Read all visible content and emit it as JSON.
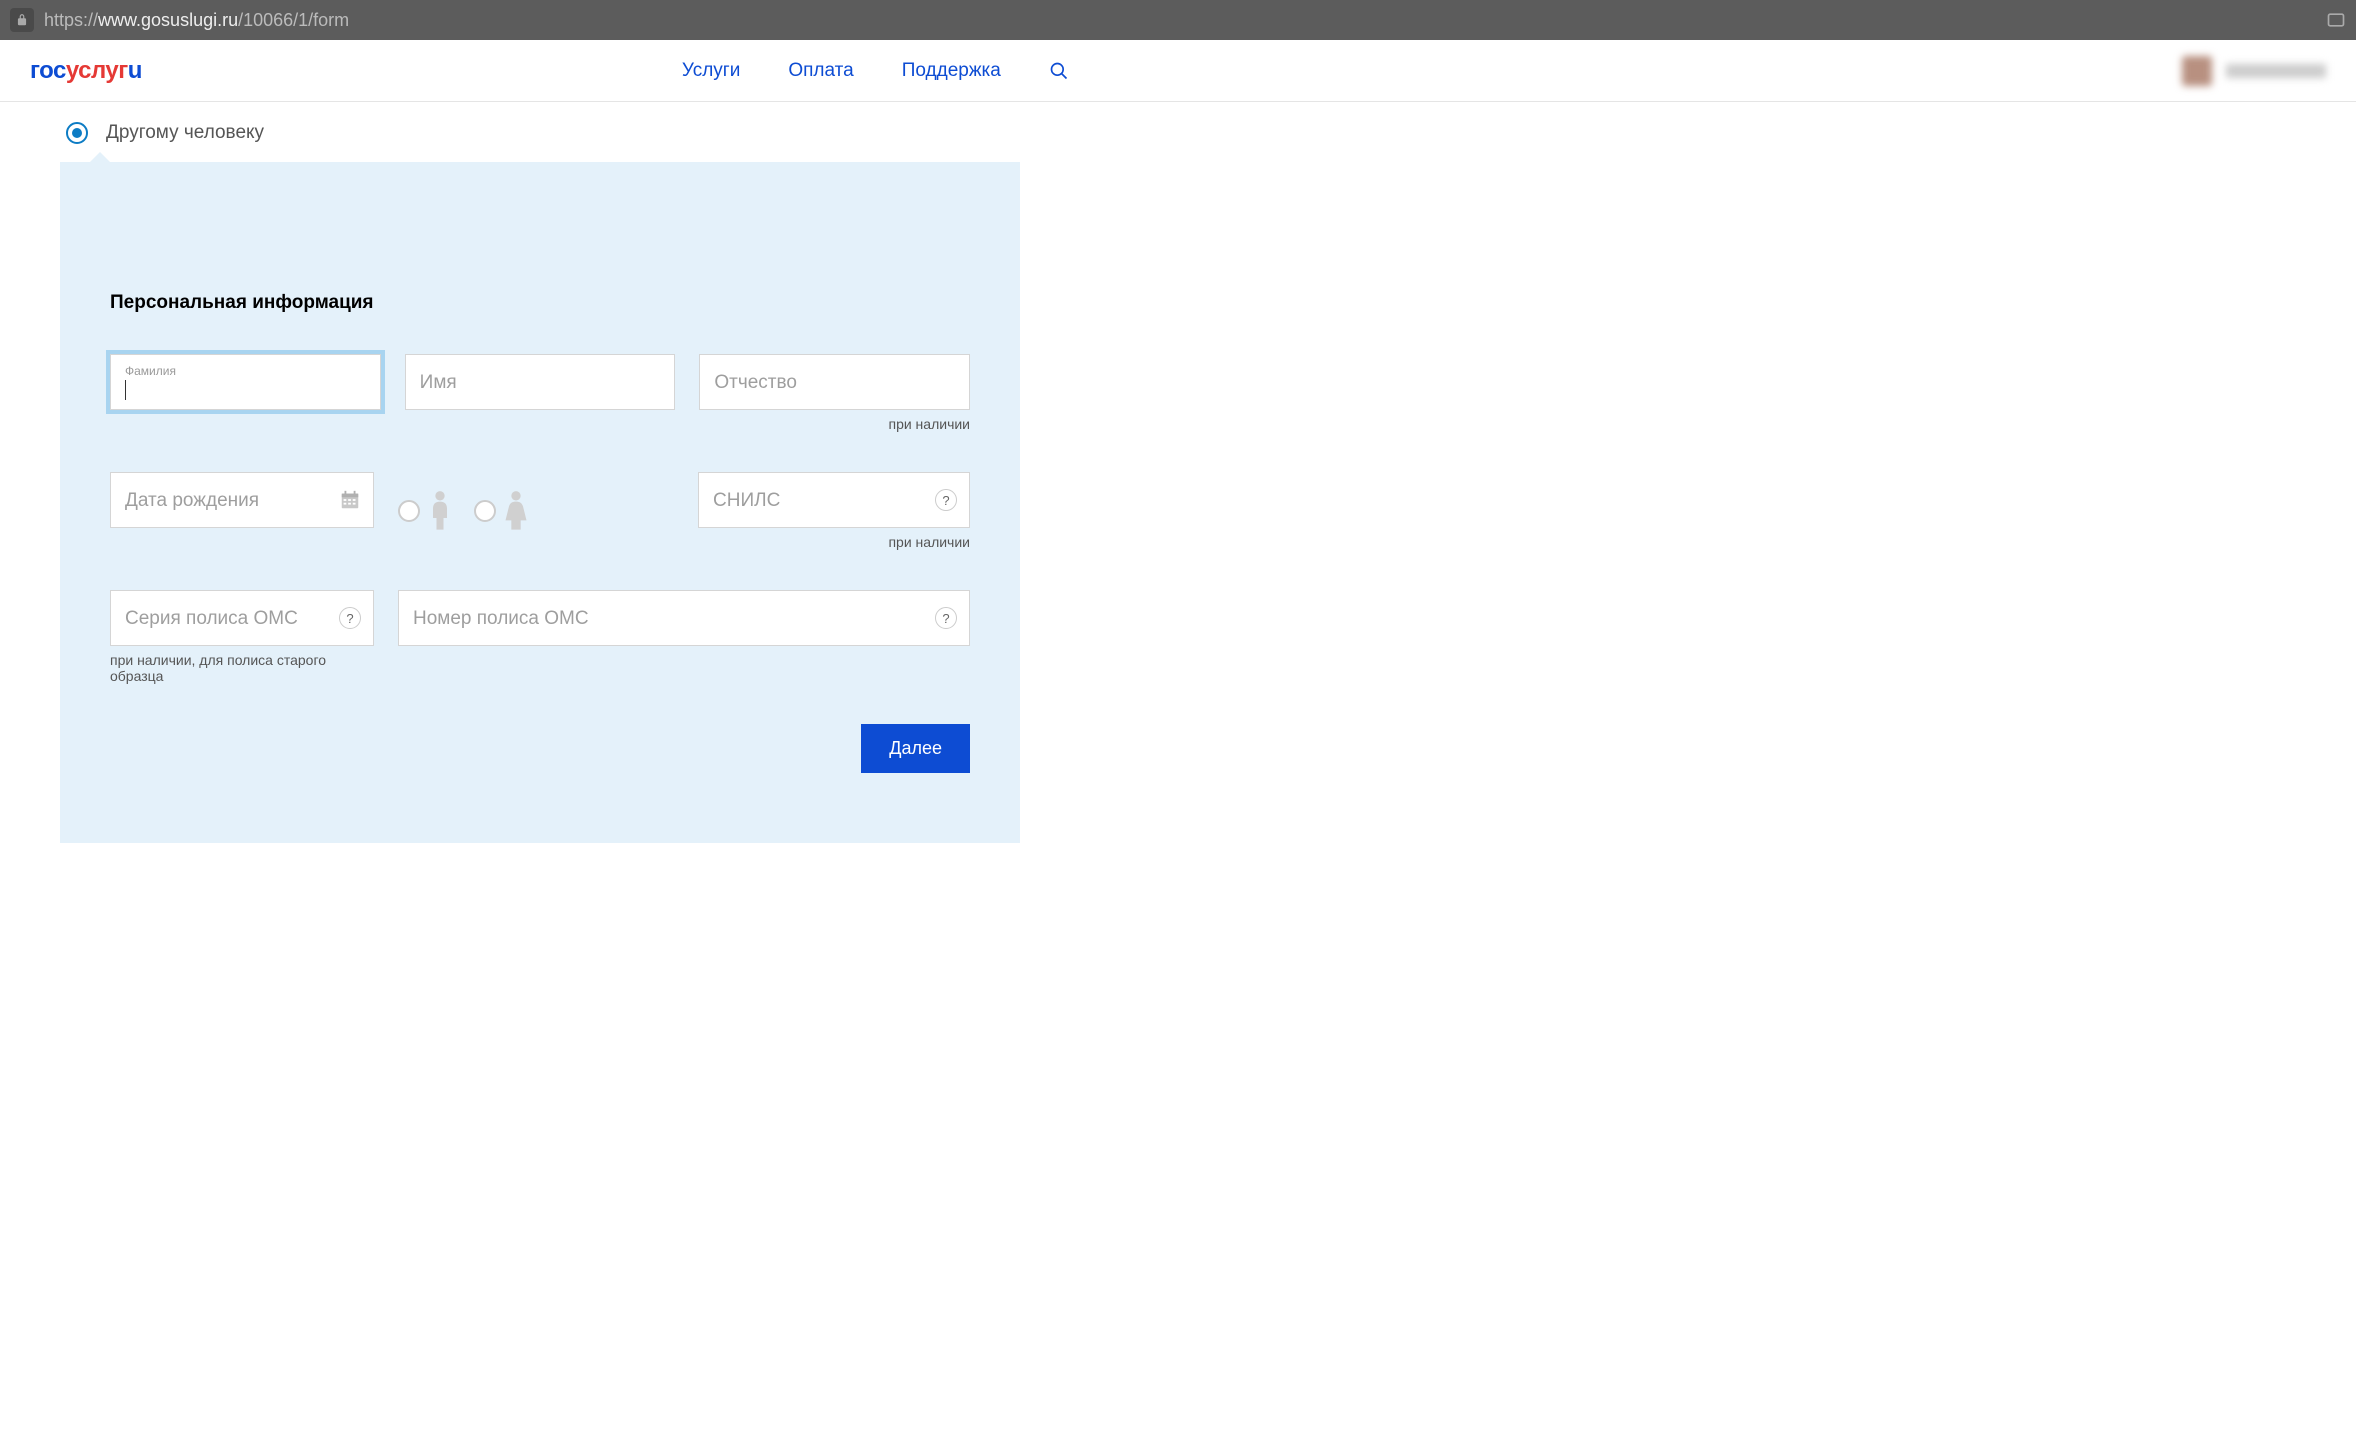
{
  "browser": {
    "url_prefix": "https://",
    "url_domain": "www.gosuslugi.ru",
    "url_path": "/10066/1/form"
  },
  "header": {
    "logo_p1": "гос",
    "logo_p2": "услуг",
    "logo_p3": "u",
    "nav": {
      "services": "Услуги",
      "payment": "Оплата",
      "support": "Поддержка"
    }
  },
  "radio": {
    "other_person": "Другому человеку"
  },
  "form": {
    "section_title": "Персональная информация",
    "lastname_label": "Фамилия",
    "firstname_ph": "Имя",
    "middlename_ph": "Отчество",
    "middlename_hint": "при наличии",
    "dob_ph": "Дата рождения",
    "snils_ph": "СНИЛС",
    "snils_hint": "при наличии",
    "oms_series_ph": "Серия полиса ОМС",
    "oms_series_hint": "при наличии, для полиса старого образца",
    "oms_number_ph": "Номер полиса ОМС",
    "help_char": "?",
    "submit": "Далее"
  }
}
